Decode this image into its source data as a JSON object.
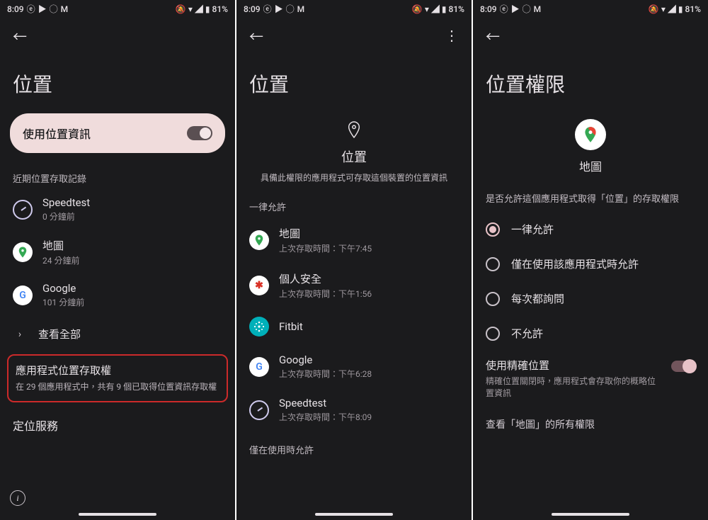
{
  "status": {
    "time": "8:09",
    "battery": "81%"
  },
  "screen1": {
    "title": "位置",
    "use_location_label": "使用位置資訊",
    "recent_label": "近期位置存取記錄",
    "apps": [
      {
        "name": "Speedtest",
        "sub": "0 分鐘前"
      },
      {
        "name": "地圖",
        "sub": "24 分鐘前"
      },
      {
        "name": "Google",
        "sub": "101 分鐘前"
      }
    ],
    "see_all": "查看全部",
    "perm": {
      "title": "應用程式位置存取權",
      "sub": "在 29 個應用程式中，共有 9 個已取得位置資訊存取權"
    },
    "loc_services": "定位服務"
  },
  "screen2": {
    "title": "位置",
    "heading": "位置",
    "desc": "具備此權限的應用程式可存取這個裝置的位置資訊",
    "cat_always": "一律允許",
    "cat_in_use": "僅在使用時允許",
    "apps": [
      {
        "name": "地圖",
        "sub": "上次存取時間：下午7:45"
      },
      {
        "name": "個人安全",
        "sub": "上次存取時間：下午1:56"
      },
      {
        "name": "Fitbit",
        "sub": ""
      },
      {
        "name": "Google",
        "sub": "上次存取時間：下午6:28"
      },
      {
        "name": "Speedtest",
        "sub": "上次存取時間：下午8:09"
      }
    ]
  },
  "screen3": {
    "title": "位置權限",
    "app_name": "地圖",
    "prompt": "是否允許這個應用程式取得「位置」的存取權限",
    "options": [
      "一律允許",
      "僅在使用該應用程式時允許",
      "每次都詢問",
      "不允許"
    ],
    "precise": {
      "title": "使用精確位置",
      "sub": "精確位置關閉時，應用程式會存取你的概略位置資訊"
    },
    "see_all": "查看「地圖」的所有權限"
  }
}
